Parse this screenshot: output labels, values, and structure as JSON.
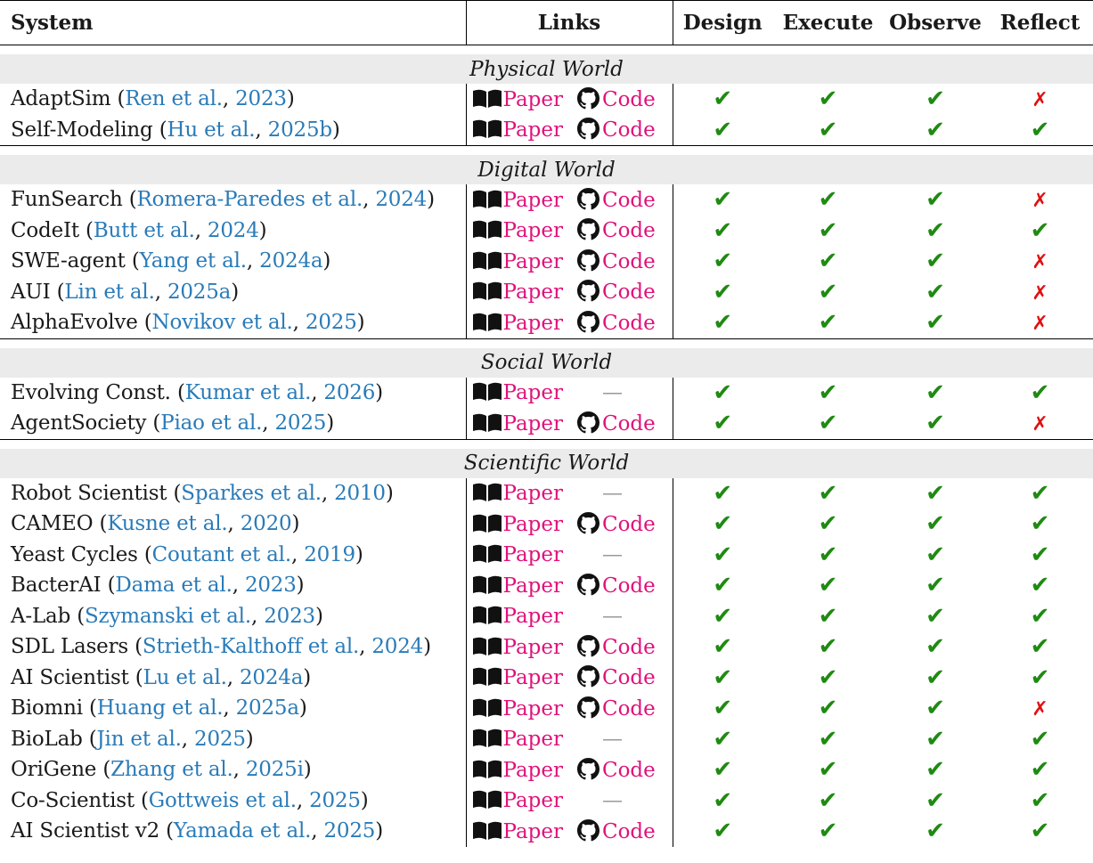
{
  "header": {
    "system": "System",
    "links": "Links",
    "design": "Design",
    "execute": "Execute",
    "observe": "Observe",
    "reflect": "Reflect"
  },
  "labels": {
    "paper": "Paper",
    "code": "Code",
    "dash": "—"
  },
  "colors": {
    "check": "#1f8a12",
    "cross": "#e01010",
    "link": "#e0127a",
    "cite": "#2a7bb8",
    "group_bg": "#ebebeb"
  },
  "groups": [
    {
      "name": "Physical World",
      "rows": [
        {
          "system": "AdaptSim",
          "cite_authors": "Ren et al.",
          "cite_year": "2023",
          "code": true,
          "marks": [
            "check",
            "check",
            "check",
            "cross"
          ]
        },
        {
          "system": "Self-Modeling",
          "cite_authors": "Hu et al.",
          "cite_year": "2025b",
          "code": true,
          "marks": [
            "check",
            "check",
            "check",
            "check"
          ]
        }
      ]
    },
    {
      "name": "Digital World",
      "rows": [
        {
          "system": "FunSearch",
          "cite_authors": "Romera-Paredes et al.",
          "cite_year": "2024",
          "code": true,
          "marks": [
            "check",
            "check",
            "check",
            "cross"
          ]
        },
        {
          "system": "CodeIt",
          "cite_authors": "Butt et al.",
          "cite_year": "2024",
          "code": true,
          "marks": [
            "check",
            "check",
            "check",
            "check"
          ]
        },
        {
          "system": "SWE-agent",
          "cite_authors": "Yang et al.",
          "cite_year": "2024a",
          "code": true,
          "marks": [
            "check",
            "check",
            "check",
            "cross"
          ]
        },
        {
          "system": "AUI",
          "cite_authors": "Lin et al.",
          "cite_year": "2025a",
          "code": true,
          "marks": [
            "check",
            "check",
            "check",
            "cross"
          ]
        },
        {
          "system": "AlphaEvolve",
          "cite_authors": "Novikov et al.",
          "cite_year": "2025",
          "code": true,
          "marks": [
            "check",
            "check",
            "check",
            "cross"
          ]
        }
      ]
    },
    {
      "name": "Social World",
      "rows": [
        {
          "system": "Evolving Const.",
          "cite_authors": "Kumar et al.",
          "cite_year": "2026",
          "code": false,
          "marks": [
            "check",
            "check",
            "check",
            "check"
          ]
        },
        {
          "system": "AgentSociety",
          "cite_authors": "Piao et al.",
          "cite_year": "2025",
          "code": true,
          "marks": [
            "check",
            "check",
            "check",
            "cross"
          ]
        }
      ]
    },
    {
      "name": "Scientific World",
      "rows": [
        {
          "system": "Robot Scientist",
          "cite_authors": "Sparkes et al.",
          "cite_year": "2010",
          "code": false,
          "marks": [
            "check",
            "check",
            "check",
            "check"
          ]
        },
        {
          "system": "CAMEO",
          "cite_authors": "Kusne et al.",
          "cite_year": "2020",
          "code": true,
          "marks": [
            "check",
            "check",
            "check",
            "check"
          ]
        },
        {
          "system": "Yeast Cycles",
          "cite_authors": "Coutant et al.",
          "cite_year": "2019",
          "code": false,
          "marks": [
            "check",
            "check",
            "check",
            "check"
          ]
        },
        {
          "system": "BacterAI",
          "cite_authors": "Dama et al.",
          "cite_year": "2023",
          "code": true,
          "marks": [
            "check",
            "check",
            "check",
            "check"
          ]
        },
        {
          "system": "A-Lab",
          "cite_authors": "Szymanski et al.",
          "cite_year": "2023",
          "code": false,
          "marks": [
            "check",
            "check",
            "check",
            "check"
          ]
        },
        {
          "system": "SDL Lasers",
          "cite_authors": "Strieth-Kalthoff et al.",
          "cite_year": "2024",
          "code": true,
          "marks": [
            "check",
            "check",
            "check",
            "check"
          ]
        },
        {
          "system": "AI Scientist",
          "cite_authors": "Lu et al.",
          "cite_year": "2024a",
          "code": true,
          "marks": [
            "check",
            "check",
            "check",
            "check"
          ]
        },
        {
          "system": "Biomni",
          "cite_authors": "Huang et al.",
          "cite_year": "2025a",
          "code": true,
          "marks": [
            "check",
            "check",
            "check",
            "cross"
          ]
        },
        {
          "system": "BioLab",
          "cite_authors": "Jin et al.",
          "cite_year": "2025",
          "code": false,
          "marks": [
            "check",
            "check",
            "check",
            "check"
          ]
        },
        {
          "system": "OriGene",
          "cite_authors": "Zhang et al.",
          "cite_year": "2025i",
          "code": true,
          "marks": [
            "check",
            "check",
            "check",
            "check"
          ]
        },
        {
          "system": "Co-Scientist",
          "cite_authors": "Gottweis et al.",
          "cite_year": "2025",
          "code": false,
          "marks": [
            "check",
            "check",
            "check",
            "check"
          ]
        },
        {
          "system": "AI Scientist v2",
          "cite_authors": "Yamada et al.",
          "cite_year": "2025",
          "code": true,
          "marks": [
            "check",
            "check",
            "check",
            "check"
          ]
        }
      ]
    }
  ]
}
